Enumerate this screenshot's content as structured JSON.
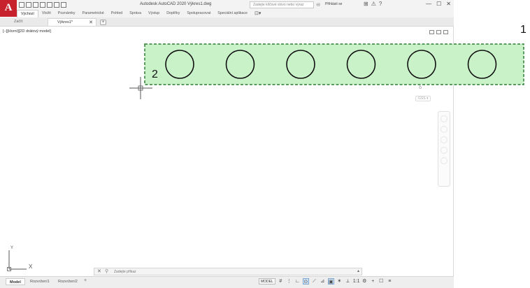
{
  "app": {
    "logo": "A",
    "title": "Autodesk AutoCAD 2020   Výkres1.dwg",
    "search_placeholder": "Zadejte klíčové slovo nebo výraz",
    "signin": "Přihlásit se",
    "window_controls": [
      "—",
      "☐",
      "✕"
    ]
  },
  "ribbon": {
    "tabs": [
      "Výchozí",
      "Vložit",
      "Poznámky",
      "Parametrické",
      "Pohled",
      "Správa",
      "Výstup",
      "Doplňky",
      "Spolupracovat",
      "Speciální aplikace"
    ],
    "active_index": 0,
    "more": "⊡▾"
  },
  "documents": {
    "tabs": [
      {
        "label": "Začít",
        "active": false
      },
      {
        "label": "Výkres1*",
        "active": true
      }
    ],
    "close_glyph": "✕",
    "new_glyph": "+"
  },
  "viewport": {
    "label": "[−][Horní][2D drátový model]",
    "viewcube_label": "GSS ▾"
  },
  "drawing": {
    "selection_color": "#c9f2c9",
    "selection_border": "#2e7d32",
    "circle_count": 6,
    "ucs": {
      "y": "Y",
      "x": "X"
    }
  },
  "annotations": {
    "marker_1": "1",
    "marker_2": "2"
  },
  "command_line": {
    "placeholder": "Zadejte příkaz",
    "close": "✕",
    "tool": "⚲"
  },
  "status_bar": {
    "layout_tabs": [
      "Model",
      "Rozvržení1",
      "Rozvržení2"
    ],
    "add": "+",
    "model_space": "MODEL",
    "icons": [
      "#",
      "⋮",
      "∟",
      "⊙",
      "⟋",
      "⊿",
      "▣",
      "✶",
      "⟂",
      "1:1",
      "⚙",
      "+",
      "☐",
      "≡"
    ]
  }
}
